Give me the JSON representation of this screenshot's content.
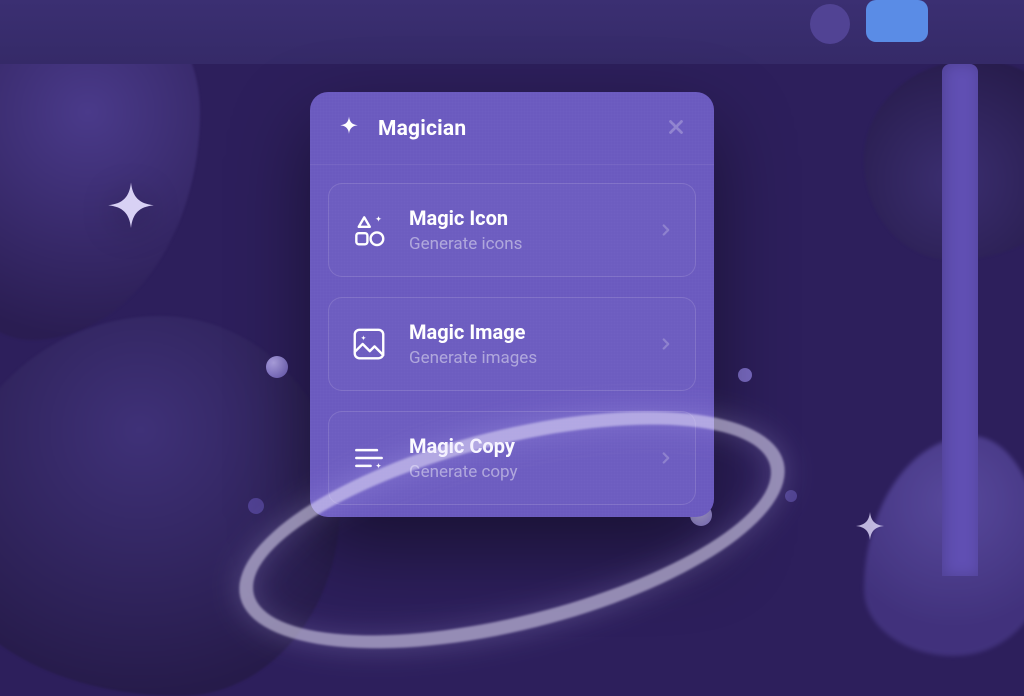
{
  "panel": {
    "title": "Magician",
    "options": [
      {
        "title": "Magic Icon",
        "subtitle": "Generate icons"
      },
      {
        "title": "Magic Image",
        "subtitle": "Generate images"
      },
      {
        "title": "Magic Copy",
        "subtitle": "Generate copy"
      }
    ]
  },
  "colors": {
    "accent": "#6b5abf",
    "top_button": "#5a8ce6"
  }
}
